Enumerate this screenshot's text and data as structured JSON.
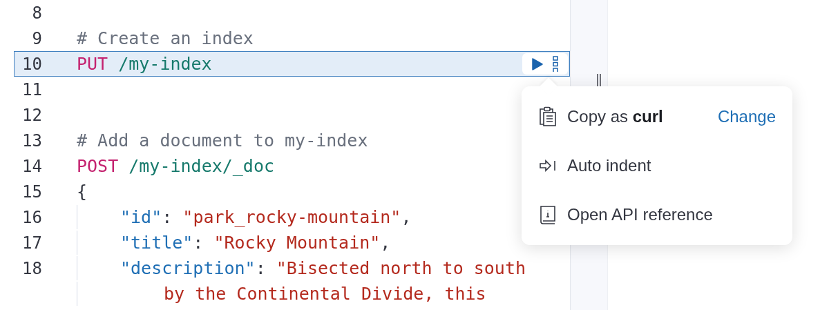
{
  "editor": {
    "lines": [
      {
        "number": "8",
        "selected": false
      },
      {
        "number": "9",
        "selected": false,
        "tokens": [
          {
            "kind": "comment",
            "text": "# Create an index"
          }
        ]
      },
      {
        "number": "10",
        "selected": true,
        "tokens": [
          {
            "kind": "method",
            "text": "PUT"
          },
          {
            "kind": "path",
            "text": " /my-index"
          }
        ]
      },
      {
        "number": "11",
        "selected": false
      },
      {
        "number": "12",
        "selected": false
      },
      {
        "number": "13",
        "selected": false,
        "tokens": [
          {
            "kind": "comment",
            "text": "# Add a document to my-index"
          }
        ]
      },
      {
        "number": "14",
        "selected": false,
        "tokens": [
          {
            "kind": "method",
            "text": "POST"
          },
          {
            "kind": "path",
            "text": " /my-index/_doc"
          }
        ]
      },
      {
        "number": "15",
        "selected": false,
        "tokens": [
          {
            "kind": "punct",
            "text": "{"
          }
        ],
        "children": [
          {
            "number": "16",
            "selected": false,
            "tokens": [
              {
                "kind": "key",
                "text": "\"id\""
              },
              {
                "kind": "punct",
                "text": ": "
              },
              {
                "kind": "string",
                "text": "\"park_rocky-mountain\""
              },
              {
                "kind": "punct",
                "text": ","
              }
            ]
          },
          {
            "number": "17",
            "selected": false,
            "tokens": [
              {
                "kind": "key",
                "text": "\"title\""
              },
              {
                "kind": "punct",
                "text": ": "
              },
              {
                "kind": "string",
                "text": "\"Rocky Mountain\""
              },
              {
                "kind": "punct",
                "text": ","
              }
            ]
          },
          {
            "number": "18",
            "selected": false,
            "tokens": [
              {
                "kind": "key",
                "text": "\"description\""
              },
              {
                "kind": "punct",
                "text": ": "
              },
              {
                "kind": "string",
                "text": "\"Bisected north to south"
              }
            ],
            "children": [
              {
                "selected": false,
                "tokens": [
                  {
                    "kind": "string",
                    "text": "by the Continental Divide, this"
                  }
                ]
              }
            ]
          }
        ]
      }
    ]
  },
  "menu": {
    "items": [
      {
        "kind": "copy",
        "label": "Copy as **curl**",
        "action": "Change"
      },
      {
        "kind": "indent",
        "label": "Auto indent"
      },
      {
        "kind": "docs",
        "label": "Open API reference"
      }
    ]
  }
}
